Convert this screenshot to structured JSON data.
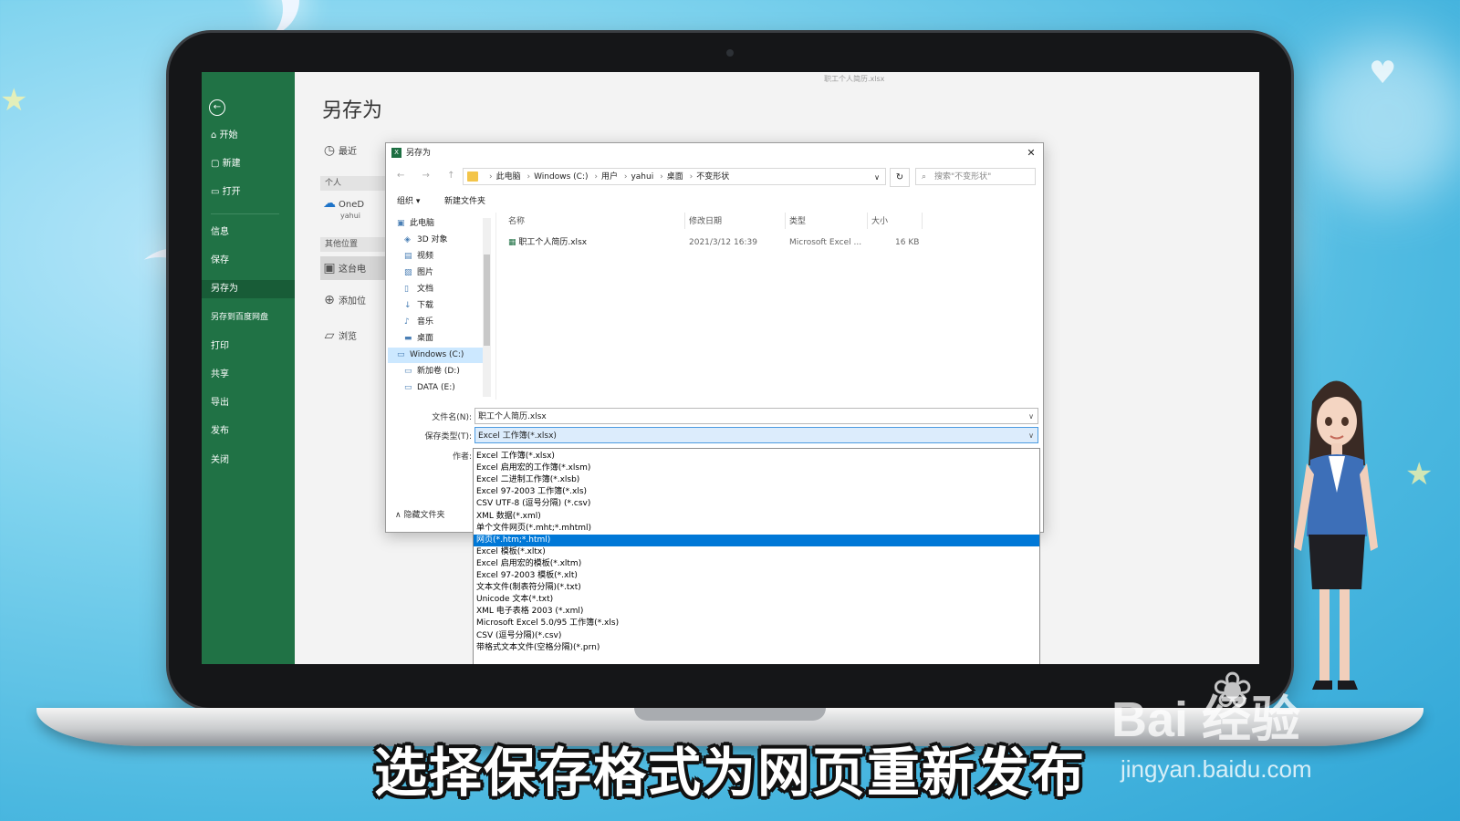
{
  "excel": {
    "doc_name": "职工个人简历.xlsx",
    "back_label": "←",
    "nav": [
      "开始",
      "新建",
      "打开",
      "信息",
      "保存",
      "另存为",
      "另存到百度网盘",
      "打印",
      "共享",
      "导出",
      "发布",
      "关闭"
    ],
    "page_title": "另存为",
    "places": {
      "recent": "最近",
      "personal_header": "个人",
      "onedrive": "OneD",
      "onedrive_user": "yahui",
      "other_header": "其他位置",
      "this_pc": "这台电",
      "add_place": "添加位",
      "browse": "浏览"
    }
  },
  "dialog": {
    "title": "另存为",
    "close": "✕",
    "nav_arrows": "← → ↑",
    "path": [
      "此电脑",
      "Windows (C:)",
      "用户",
      "yahui",
      "桌面",
      "不变形状"
    ],
    "refresh": "↻",
    "search_placeholder": "搜索\"不变形状\"",
    "organize": "组织 ▾",
    "new_folder": "新建文件夹",
    "tree": [
      "此电脑",
      "3D 对象",
      "视频",
      "图片",
      "文档",
      "下载",
      "音乐",
      "桌面",
      "Windows (C:)",
      "新加卷 (D:)",
      "DATA (E:)"
    ],
    "columns": [
      "名称",
      "修改日期",
      "类型",
      "大小"
    ],
    "file": {
      "name": "职工个人简历.xlsx",
      "date": "2021/3/12 16:39",
      "type": "Microsoft Excel ...",
      "size": "16 KB"
    },
    "filename_label": "文件名(N):",
    "filename_value": "职工个人简历.xlsx",
    "savetype_label": "保存类型(T):",
    "savetype_value": "Excel 工作簿(*.xlsx)",
    "author_label": "作者:",
    "hide_folders": "∧ 隐藏文件夹",
    "chevron": "∨"
  },
  "dropdown_options": [
    "Excel 工作簿(*.xlsx)",
    "Excel 启用宏的工作簿(*.xlsm)",
    "Excel 二进制工作簿(*.xlsb)",
    "Excel 97-2003 工作簿(*.xls)",
    "CSV UTF-8 (逗号分隔) (*.csv)",
    "XML 数据(*.xml)",
    "单个文件网页(*.mht;*.mhtml)",
    "网页(*.htm;*.html)",
    "Excel 模板(*.xltx)",
    "Excel 启用宏的模板(*.xltm)",
    "Excel 97-2003 模板(*.xlt)",
    "文本文件(制表符分隔)(*.txt)",
    "Unicode 文本(*.txt)",
    "XML 电子表格 2003 (*.xml)",
    "Microsoft Excel 5.0/95 工作簿(*.xls)",
    "CSV (逗号分隔)(*.csv)",
    "带格式文本文件(空格分隔)(*.prn)"
  ],
  "highlighted_option": 7,
  "caption": "选择保存格式为网页重新发布",
  "watermark": {
    "brand": "Bai  经验",
    "url": "jingyan.baidu.com"
  },
  "colors": {
    "excel_green": "#207245",
    "highlight": "#0078d7"
  }
}
